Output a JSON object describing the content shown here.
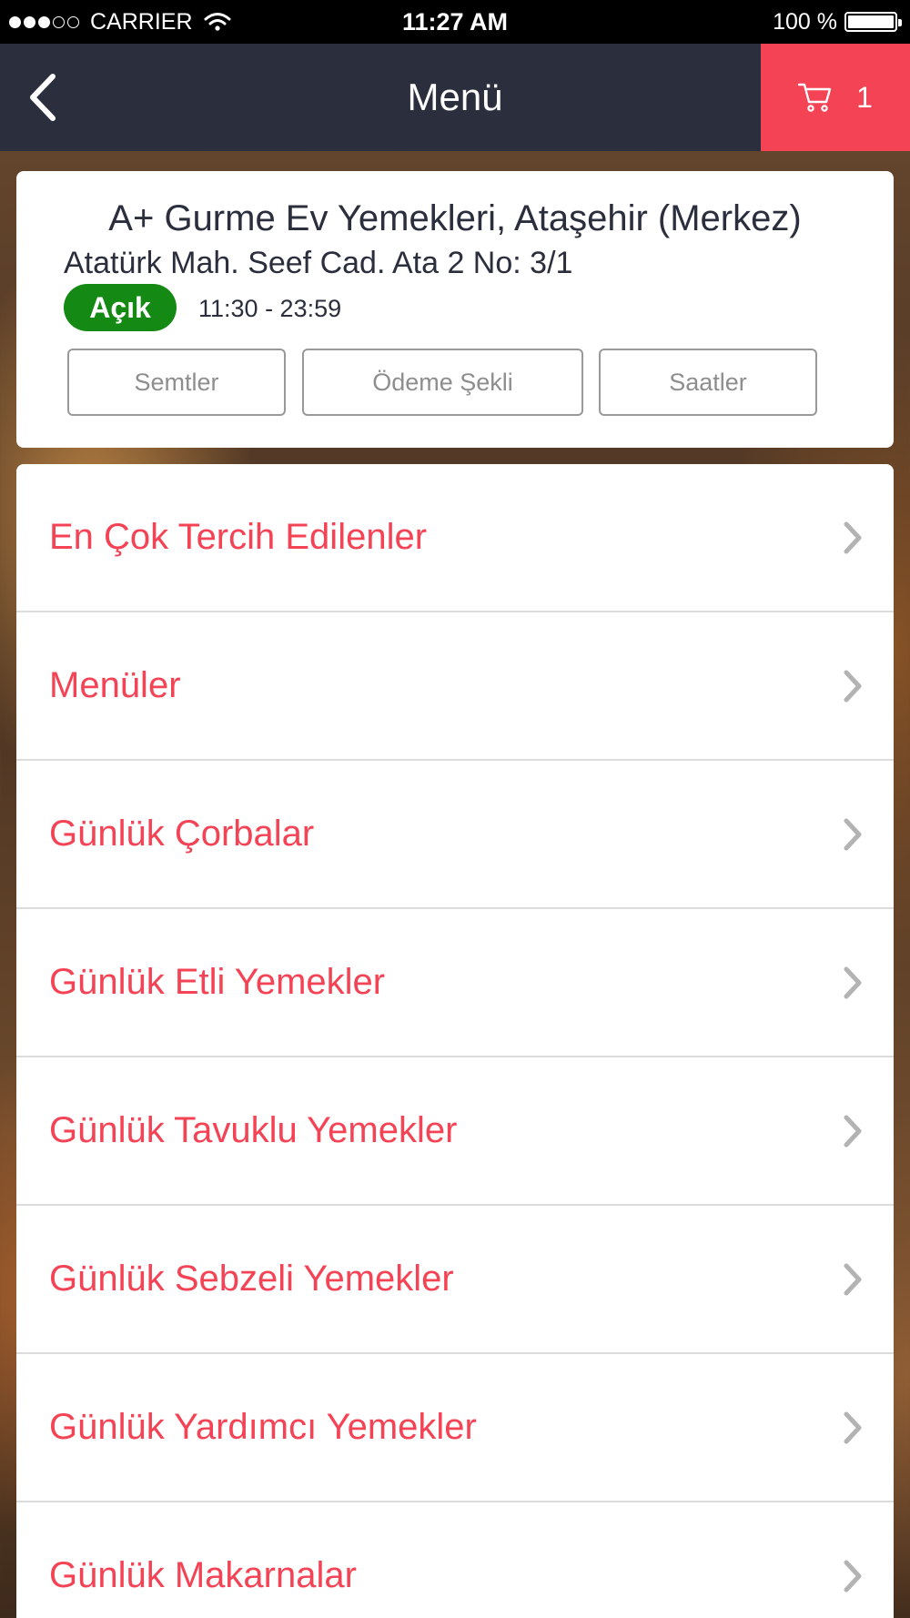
{
  "status_bar": {
    "carrier": "CARRIER",
    "time": "11:27 AM",
    "battery": "100 %",
    "signal_bars_filled": 3,
    "signal_bars_total": 5
  },
  "nav": {
    "title": "Menü",
    "cart_count": "1",
    "icons": {
      "back": "chevron-left-icon",
      "cart": "cart-icon"
    }
  },
  "restaurant": {
    "name": "A+ Gurme Ev Yemekleri, Ataşehir (Merkez)",
    "address": "Atatürk Mah. Seef Cad. Ata 2 No: 3/1",
    "status": "Açık",
    "hours": "11:30 - 23:59",
    "buttons": {
      "semtler": "Semtler",
      "odeme": "Ödeme Şekli",
      "saatler": "Saatler"
    }
  },
  "menu": {
    "items": [
      {
        "label": "En Çok Tercih Edilenler"
      },
      {
        "label": "Menüler"
      },
      {
        "label": "Günlük Çorbalar"
      },
      {
        "label": "Günlük Etli Yemekler"
      },
      {
        "label": "Günlük Tavuklu Yemekler"
      },
      {
        "label": "Günlük Sebzeli Yemekler"
      },
      {
        "label": "Günlük Yardımcı Yemekler"
      },
      {
        "label": "Günlük Makarnalar"
      }
    ]
  },
  "colors": {
    "nav_background": "#2b2e3d",
    "accent": "#f44355",
    "status_open": "#148a14",
    "menu_text": "#f44355"
  }
}
